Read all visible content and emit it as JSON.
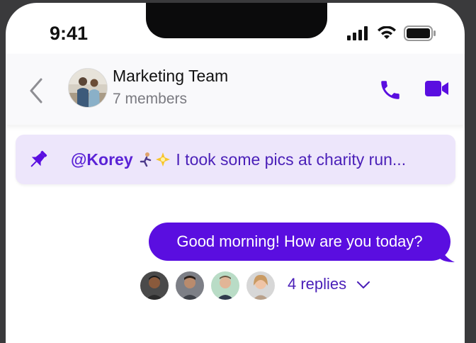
{
  "status_bar": {
    "time": "9:41"
  },
  "header": {
    "title": "Marketing Team",
    "subtitle": "7 members"
  },
  "pinned": {
    "mention": "@Korey",
    "text": " I took some pics at charity run..."
  },
  "message": {
    "text": "Good morning! How are you today?"
  },
  "thread": {
    "replies_label": "4 replies"
  },
  "colors": {
    "accent": "#5a0ee0",
    "pinned_bg": "#ede6fb",
    "pinned_text": "#4a1fb8"
  }
}
